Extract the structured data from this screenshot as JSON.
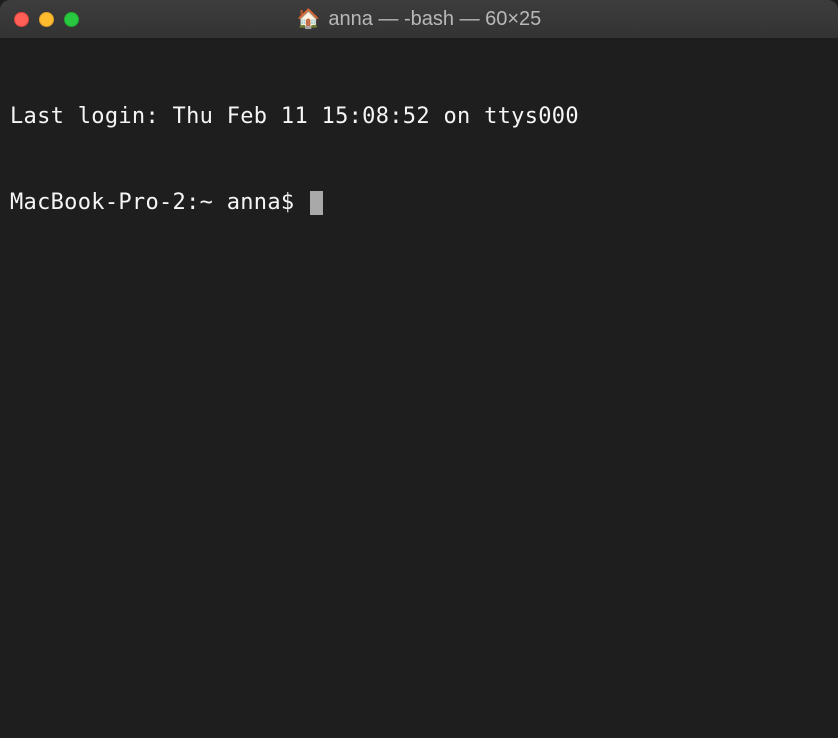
{
  "window": {
    "title_icon": "🏠",
    "title": "anna — -bash — 60×25"
  },
  "terminal": {
    "last_login": "Last login: Thu Feb 11 15:08:52 on ttys000",
    "prompt": "MacBook-Pro-2:~ anna$ "
  }
}
